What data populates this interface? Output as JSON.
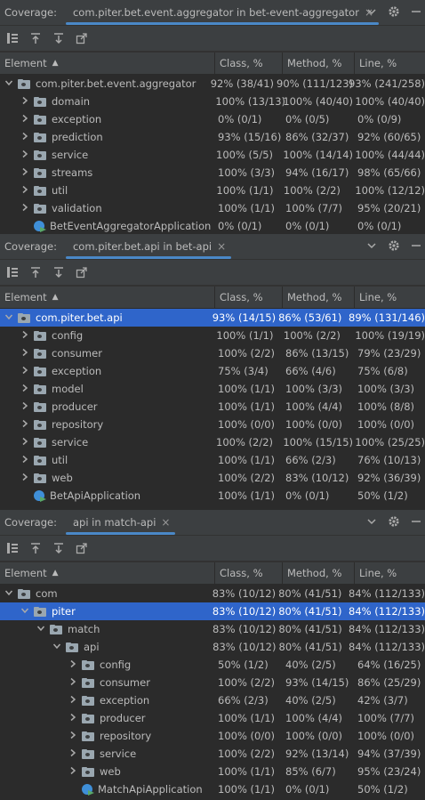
{
  "panels": [
    {
      "coverage_label": "Coverage:",
      "tab_title": "com.piter.bet.event.aggregator in bet-event-aggregator",
      "headers": {
        "element": "Element",
        "class": "Class, %",
        "method": "Method, %",
        "line": "Line, %"
      },
      "rows": [
        {
          "indent": 0,
          "expand": "open",
          "icon": "folder",
          "name": "com.piter.bet.event.aggregator",
          "class": "92% (38/41)",
          "method": "90% (111/123)",
          "line": "93% (241/258)",
          "selected": false
        },
        {
          "indent": 1,
          "expand": "closed",
          "icon": "folder",
          "name": "domain",
          "class": "100% (13/13)",
          "method": "100% (40/40)",
          "line": "100% (40/40)",
          "selected": false
        },
        {
          "indent": 1,
          "expand": "closed",
          "icon": "folder",
          "name": "exception",
          "class": "0% (0/1)",
          "method": "0% (0/5)",
          "line": "0% (0/9)",
          "selected": false
        },
        {
          "indent": 1,
          "expand": "closed",
          "icon": "folder",
          "name": "prediction",
          "class": "93% (15/16)",
          "method": "86% (32/37)",
          "line": "92% (60/65)",
          "selected": false
        },
        {
          "indent": 1,
          "expand": "closed",
          "icon": "folder",
          "name": "service",
          "class": "100% (5/5)",
          "method": "100% (14/14)",
          "line": "100% (44/44)",
          "selected": false
        },
        {
          "indent": 1,
          "expand": "closed",
          "icon": "folder",
          "name": "streams",
          "class": "100% (3/3)",
          "method": "94% (16/17)",
          "line": "98% (65/66)",
          "selected": false
        },
        {
          "indent": 1,
          "expand": "closed",
          "icon": "folder",
          "name": "util",
          "class": "100% (1/1)",
          "method": "100% (2/2)",
          "line": "100% (12/12)",
          "selected": false
        },
        {
          "indent": 1,
          "expand": "closed",
          "icon": "folder",
          "name": "validation",
          "class": "100% (1/1)",
          "method": "100% (7/7)",
          "line": "95% (20/21)",
          "selected": false
        },
        {
          "indent": 1,
          "expand": "none",
          "icon": "app",
          "name": "BetEventAggregatorApplication",
          "class": "0% (0/1)",
          "method": "0% (0/1)",
          "line": "0% (0/1)",
          "selected": false
        }
      ]
    },
    {
      "coverage_label": "Coverage:",
      "tab_title": "com.piter.bet.api in bet-api",
      "headers": {
        "element": "Element",
        "class": "Class, %",
        "method": "Method, %",
        "line": "Line, %"
      },
      "rows": [
        {
          "indent": 0,
          "expand": "open",
          "icon": "folder",
          "name": "com.piter.bet.api",
          "class": "93% (14/15)",
          "method": "86% (53/61)",
          "line": "89% (131/146)",
          "selected": true
        },
        {
          "indent": 1,
          "expand": "closed",
          "icon": "folder",
          "name": "config",
          "class": "100% (1/1)",
          "method": "100% (2/2)",
          "line": "100% (19/19)",
          "selected": false
        },
        {
          "indent": 1,
          "expand": "closed",
          "icon": "folder",
          "name": "consumer",
          "class": "100% (2/2)",
          "method": "86% (13/15)",
          "line": "79% (23/29)",
          "selected": false
        },
        {
          "indent": 1,
          "expand": "closed",
          "icon": "folder",
          "name": "exception",
          "class": "75% (3/4)",
          "method": "66% (4/6)",
          "line": "75% (6/8)",
          "selected": false
        },
        {
          "indent": 1,
          "expand": "closed",
          "icon": "folder",
          "name": "model",
          "class": "100% (1/1)",
          "method": "100% (3/3)",
          "line": "100% (3/3)",
          "selected": false
        },
        {
          "indent": 1,
          "expand": "closed",
          "icon": "folder",
          "name": "producer",
          "class": "100% (1/1)",
          "method": "100% (4/4)",
          "line": "100% (8/8)",
          "selected": false
        },
        {
          "indent": 1,
          "expand": "closed",
          "icon": "folder",
          "name": "repository",
          "class": "100% (0/0)",
          "method": "100% (0/0)",
          "line": "100% (0/0)",
          "selected": false
        },
        {
          "indent": 1,
          "expand": "closed",
          "icon": "folder",
          "name": "service",
          "class": "100% (2/2)",
          "method": "100% (15/15)",
          "line": "100% (25/25)",
          "selected": false
        },
        {
          "indent": 1,
          "expand": "closed",
          "icon": "folder",
          "name": "util",
          "class": "100% (1/1)",
          "method": "66% (2/3)",
          "line": "76% (10/13)",
          "selected": false
        },
        {
          "indent": 1,
          "expand": "closed",
          "icon": "folder",
          "name": "web",
          "class": "100% (2/2)",
          "method": "83% (10/12)",
          "line": "92% (36/39)",
          "selected": false
        },
        {
          "indent": 1,
          "expand": "none",
          "icon": "app",
          "name": "BetApiApplication",
          "class": "100% (1/1)",
          "method": "0% (0/1)",
          "line": "50% (1/2)",
          "selected": false
        }
      ]
    },
    {
      "coverage_label": "Coverage:",
      "tab_title": "api in match-api",
      "headers": {
        "element": "Element",
        "class": "Class, %",
        "method": "Method, %",
        "line": "Line, %"
      },
      "rows": [
        {
          "indent": 0,
          "expand": "open",
          "icon": "folder",
          "name": "com",
          "class": "83% (10/12)",
          "method": "80% (41/51)",
          "line": "84% (112/133)",
          "selected": false
        },
        {
          "indent": 1,
          "expand": "open",
          "icon": "folder",
          "name": "piter",
          "class": "83% (10/12)",
          "method": "80% (41/51)",
          "line": "84% (112/133)",
          "selected": true
        },
        {
          "indent": 2,
          "expand": "open",
          "icon": "folder",
          "name": "match",
          "class": "83% (10/12)",
          "method": "80% (41/51)",
          "line": "84% (112/133)",
          "selected": false
        },
        {
          "indent": 3,
          "expand": "open",
          "icon": "folder",
          "name": "api",
          "class": "83% (10/12)",
          "method": "80% (41/51)",
          "line": "84% (112/133)",
          "selected": false
        },
        {
          "indent": 4,
          "expand": "closed",
          "icon": "folder",
          "name": "config",
          "class": "50% (1/2)",
          "method": "40% (2/5)",
          "line": "64% (16/25)",
          "selected": false
        },
        {
          "indent": 4,
          "expand": "closed",
          "icon": "folder",
          "name": "consumer",
          "class": "100% (2/2)",
          "method": "93% (14/15)",
          "line": "86% (25/29)",
          "selected": false
        },
        {
          "indent": 4,
          "expand": "closed",
          "icon": "folder",
          "name": "exception",
          "class": "66% (2/3)",
          "method": "40% (2/5)",
          "line": "42% (3/7)",
          "selected": false
        },
        {
          "indent": 4,
          "expand": "closed",
          "icon": "folder",
          "name": "producer",
          "class": "100% (1/1)",
          "method": "100% (4/4)",
          "line": "100% (7/7)",
          "selected": false
        },
        {
          "indent": 4,
          "expand": "closed",
          "icon": "folder",
          "name": "repository",
          "class": "100% (0/0)",
          "method": "100% (0/0)",
          "line": "100% (0/0)",
          "selected": false
        },
        {
          "indent": 4,
          "expand": "closed",
          "icon": "folder",
          "name": "service",
          "class": "100% (2/2)",
          "method": "92% (13/14)",
          "line": "94% (37/39)",
          "selected": false
        },
        {
          "indent": 4,
          "expand": "closed",
          "icon": "folder",
          "name": "web",
          "class": "100% (1/1)",
          "method": "85% (6/7)",
          "line": "95% (23/24)",
          "selected": false
        },
        {
          "indent": 4,
          "expand": "none",
          "icon": "app",
          "name": "MatchApiApplication",
          "class": "100% (1/1)",
          "method": "0% (0/1)",
          "line": "50% (1/2)",
          "selected": false
        }
      ]
    }
  ],
  "icons": {
    "close": "close-icon",
    "chevron": "chevron-down-icon",
    "gear": "gear-icon",
    "minimize": "minimize-icon",
    "flatten": "flatten-packages-icon",
    "import": "import-icon",
    "export": "export-icon",
    "navigate": "navigate-icon"
  },
  "colors": {
    "selection": "#2f65ca",
    "tab_underline": "#4a88c7",
    "background": "#2b2b2b"
  }
}
